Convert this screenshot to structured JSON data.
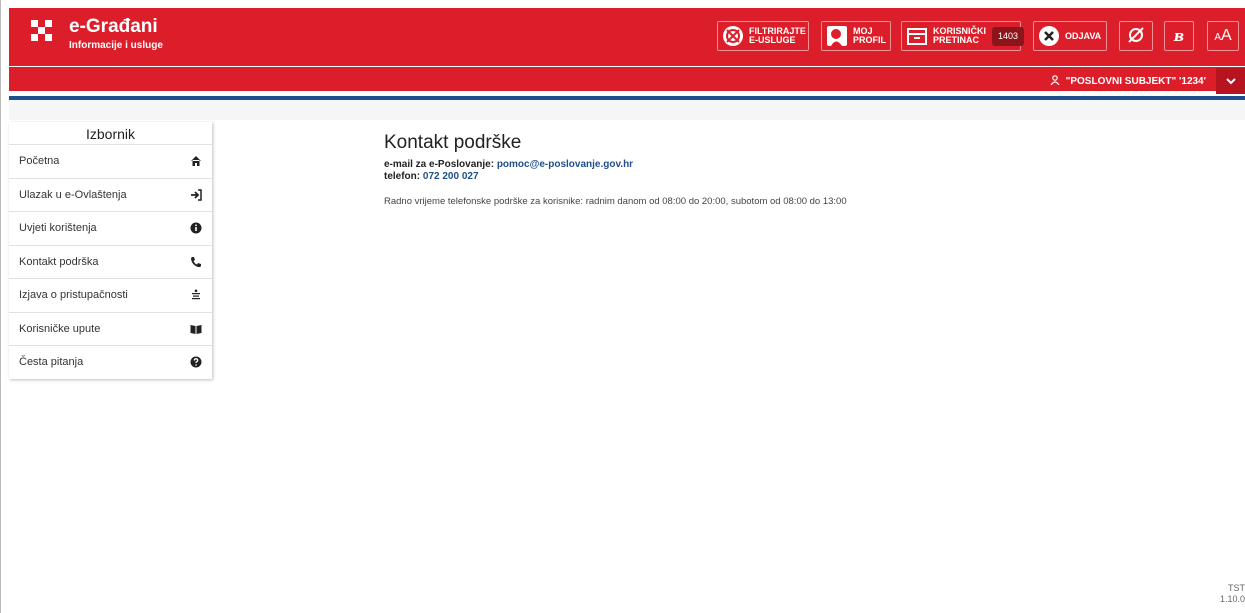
{
  "header": {
    "brand_title": "e-Građani",
    "brand_subtitle": "Informacije i usluge",
    "buttons": [
      {
        "line1": "FILTRIRAJTE",
        "line2": "E-USLUGE",
        "icon": "filter-circle-icon"
      },
      {
        "line1": "MOJ",
        "line2": "PROFIL",
        "icon": "profile-icon"
      },
      {
        "line1": "KORISNIČKI",
        "line2": "PRETINAC",
        "icon": "inbox-icon",
        "badge": "1403"
      },
      {
        "line1": "ODJAVA",
        "icon": "close-circle-icon"
      }
    ]
  },
  "userbar": {
    "subject": "\"POSLOVNI SUBJEKT\" '1234'"
  },
  "sidebar": {
    "title": "Izbornik",
    "items": [
      {
        "label": "Početna",
        "icon": "home-icon"
      },
      {
        "label": "Ulazak u e-Ovlaštenja",
        "icon": "sign-in-icon"
      },
      {
        "label": "Uvjeti korištenja",
        "icon": "info-circle-icon"
      },
      {
        "label": "Kontakt podrška",
        "icon": "phone-icon"
      },
      {
        "label": "Izjava o pristupačnosti",
        "icon": "accessibility-icon"
      },
      {
        "label": "Korisničke upute",
        "icon": "book-icon"
      },
      {
        "label": "Česta pitanja",
        "icon": "question-circle-icon"
      }
    ]
  },
  "main": {
    "title": "Kontakt podrške",
    "email_label": "e-mail za e-Poslovanje:",
    "email_value": "pomoc@e-poslovanje.gov.hr",
    "phone_label": "telefon:",
    "phone_value": "072 200 027",
    "hours": "Radno vrijeme telefonske podrške za korisnike: radnim danom od 08:00 do 20:00, subotom od 08:00 do 13:00"
  },
  "footer": {
    "env": "TST",
    "version": "1.10.0"
  },
  "colors": {
    "brand_red": "#dc1e2b",
    "dark_red": "#b8141f",
    "link_blue": "#1f4f8a"
  }
}
